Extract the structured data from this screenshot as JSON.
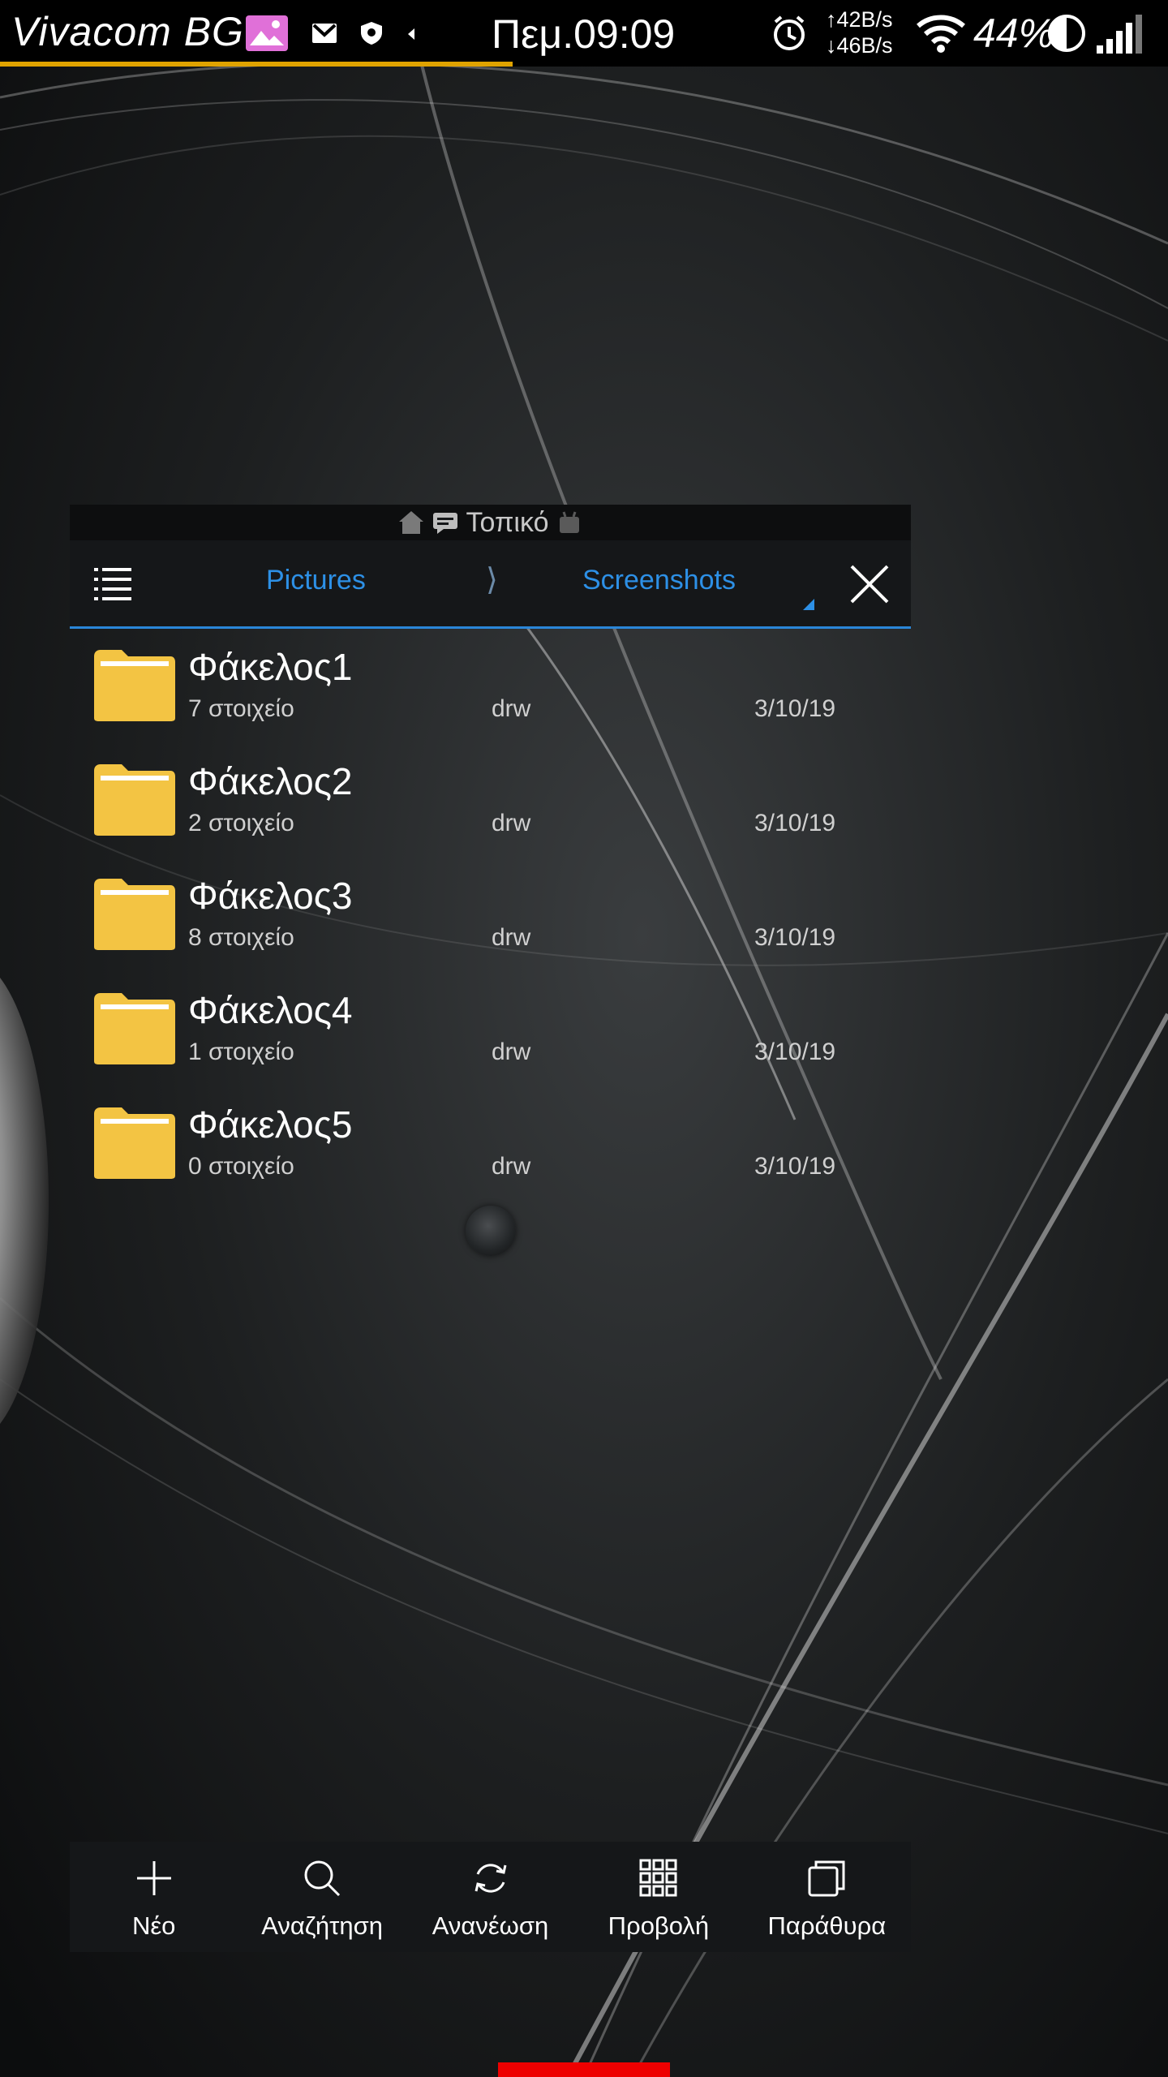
{
  "status_bar": {
    "carrier": "Vivacom BG",
    "time": "Πεμ.09:09",
    "upload_speed": "↑42B/s",
    "download_speed": "↓46B/s",
    "battery": "44%",
    "icons": [
      "gallery-icon",
      "gmail-icon",
      "shield-icon",
      "alarm-icon",
      "wifi-icon",
      "brightness-icon",
      "signal-icon"
    ]
  },
  "window": {
    "title": "Τοπικό",
    "breadcrumbs": [
      "Pictures",
      "Screenshots"
    ],
    "separator": "⟩"
  },
  "files": [
    {
      "name": "Φάκελος1",
      "count": "7 στοιχείο",
      "perm": "drw",
      "date": "3/10/19"
    },
    {
      "name": "Φάκελος2",
      "count": "2 στοιχείο",
      "perm": "drw",
      "date": "3/10/19"
    },
    {
      "name": "Φάκελος3",
      "count": "8 στοιχείο",
      "perm": "drw",
      "date": "3/10/19"
    },
    {
      "name": "Φάκελος4",
      "count": "1 στοιχείο",
      "perm": "drw",
      "date": "3/10/19"
    },
    {
      "name": "Φάκελος5",
      "count": "0 στοιχείο",
      "perm": "drw",
      "date": "3/10/19"
    }
  ],
  "bottom_bar": [
    {
      "label": "Νέο",
      "icon": "plus-icon"
    },
    {
      "label": "Αναζήτηση",
      "icon": "search-icon"
    },
    {
      "label": "Ανανέωση",
      "icon": "refresh-icon"
    },
    {
      "label": "Προβολή",
      "icon": "grid-icon"
    },
    {
      "label": "Παράθυρα",
      "icon": "windows-icon"
    }
  ],
  "colors": {
    "accent": "#2d90e6",
    "folder": "#f3c443",
    "status_progress": "#e0a300"
  }
}
